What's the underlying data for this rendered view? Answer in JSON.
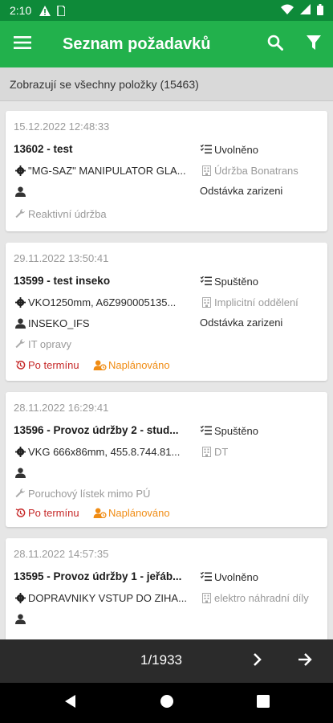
{
  "status_bar": {
    "time": "2:10"
  },
  "app_bar": {
    "title": "Seznam požadavků"
  },
  "info": {
    "text": "Zobrazují se všechny položky (15463)"
  },
  "cards": [
    {
      "date": "15.12.2022 12:48:33",
      "title": "13602 - test",
      "equipment": "\"MG-SAZ\" MANIPULATOR GLA...",
      "person": "",
      "type": "Reaktivní údržba",
      "state": "Uvolněno",
      "department": "Údržba Bonatrans",
      "reason": "Odstávka zarizeni"
    },
    {
      "date": "29.11.2022 13:50:41",
      "title": "13599 - test inseko",
      "equipment": "VKO1250mm, A6Z990005135...",
      "person": "INSEKO_IFS",
      "type": "IT opravy",
      "state": "Spuštěno",
      "department": "Implicitní oddělení",
      "reason": "Odstávka zarizeni",
      "overdue": "Po termínu",
      "planned": "Naplánováno"
    },
    {
      "date": "28.11.2022 16:29:41",
      "title": "13596 - Provoz údržby 2 - stud...",
      "equipment": "VKG 666x86mm, 455.8.744.81...",
      "person": "",
      "type": "Poruchový lístek mimo PÚ",
      "state": "Spuštěno",
      "department": "DT",
      "overdue": "Po termínu",
      "planned": "Naplánováno"
    },
    {
      "date": "28.11.2022 14:57:35",
      "title": "13595 - Provoz údržby 1 - jeřáb...",
      "equipment": "DOPRAVNIKY VSTUP DO ZIHA...",
      "person": "",
      "state": "Uvolněno",
      "department": "elektro náhradní díly"
    }
  ],
  "pager": {
    "text": "1/1933"
  },
  "colors": {
    "app_bar": "#22b14c",
    "status_bar": "#0e8a39",
    "overdue": "#c62828",
    "planned": "#f08c14"
  }
}
